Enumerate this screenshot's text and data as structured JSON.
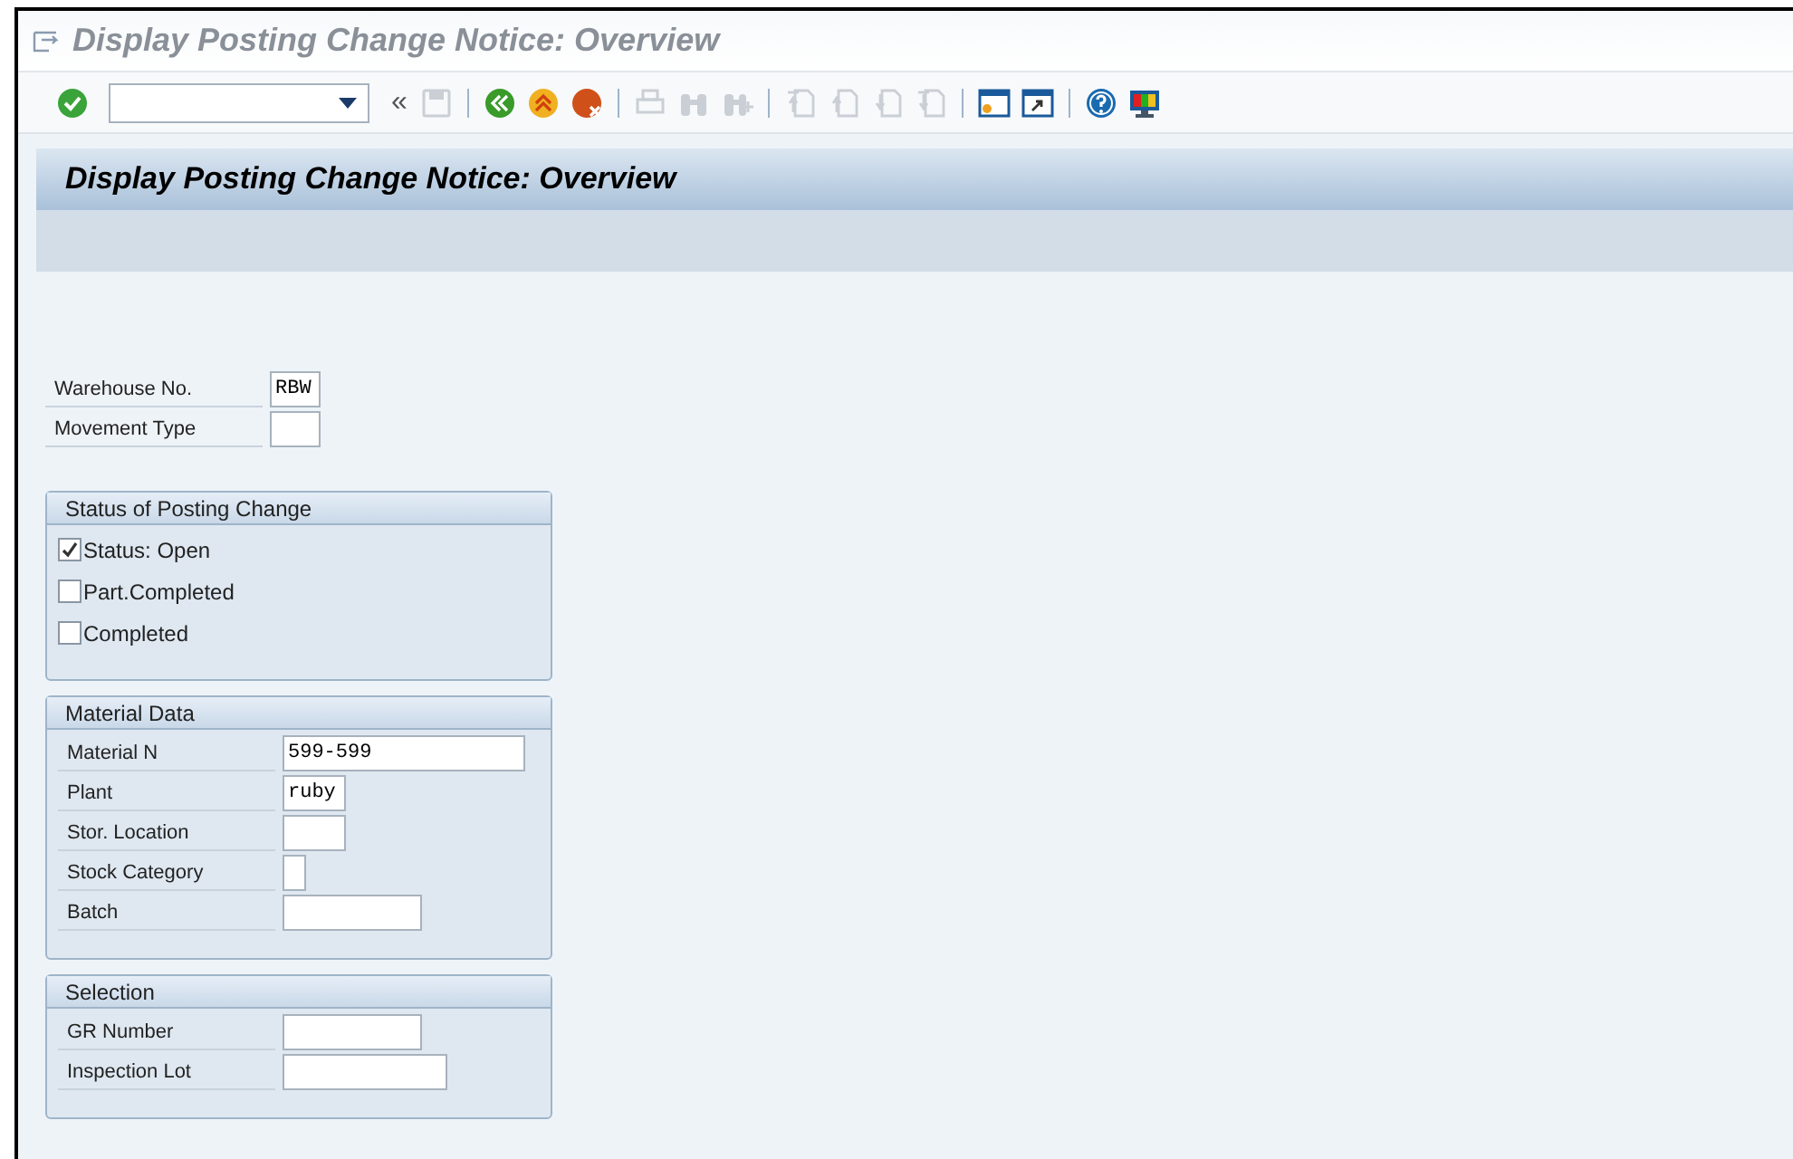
{
  "window": {
    "title": "Display Posting Change Notice: Overview"
  },
  "toolbar": [
    {
      "kind": "enter",
      "disabled": false
    },
    {
      "kind": "command-field"
    },
    {
      "kind": "collapse",
      "label": "«"
    },
    {
      "kind": "save",
      "disabled": true
    },
    {
      "kind": "separator"
    },
    {
      "kind": "back",
      "disabled": false
    },
    {
      "kind": "exit",
      "disabled": false
    },
    {
      "kind": "cancel",
      "disabled": false
    },
    {
      "kind": "separator"
    },
    {
      "kind": "print",
      "disabled": true
    },
    {
      "kind": "find",
      "disabled": true
    },
    {
      "kind": "find-next",
      "disabled": true
    },
    {
      "kind": "separator"
    },
    {
      "kind": "first-page",
      "disabled": true
    },
    {
      "kind": "previous-page",
      "disabled": true
    },
    {
      "kind": "next-page",
      "disabled": true
    },
    {
      "kind": "last-page",
      "disabled": true
    },
    {
      "kind": "separator"
    },
    {
      "kind": "new-session",
      "disabled": false
    },
    {
      "kind": "shortcut",
      "disabled": false
    },
    {
      "kind": "separator"
    },
    {
      "kind": "help",
      "disabled": false
    },
    {
      "kind": "layout",
      "disabled": false
    }
  ],
  "header": {
    "title": "Display Posting Change Notice: Overview"
  },
  "fields": [
    {
      "label": "Warehouse No.",
      "value": "RBW"
    },
    {
      "label": "Movement Type"
    }
  ],
  "status_group": {
    "title": "Status of Posting Change",
    "options": [
      {
        "label": "Status: Open",
        "checked": true
      },
      {
        "label": "Part.Completed",
        "checked": false
      },
      {
        "label": "Completed",
        "checked": false
      }
    ]
  },
  "material_group": {
    "title": "Material Data",
    "fields": [
      {
        "label": "Material N",
        "value": "599-599"
      },
      {
        "label": "Plant",
        "value": "ruby"
      },
      {
        "label": "Stor. Location"
      },
      {
        "label": "Stock Category"
      },
      {
        "label": "Batch"
      }
    ]
  },
  "selection_group": {
    "title": "Selection",
    "fields": [
      {
        "label": "GR Number"
      },
      {
        "label": "Inspection Lot"
      }
    ]
  }
}
